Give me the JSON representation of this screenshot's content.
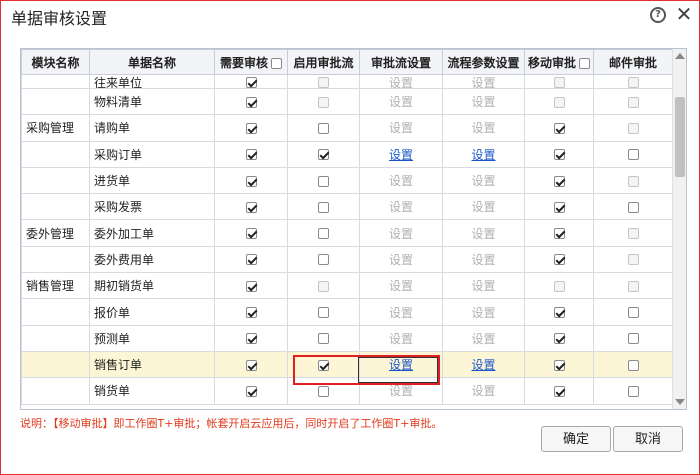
{
  "dialog": {
    "title": "单据审核设置"
  },
  "icons": {
    "help": "help-icon",
    "close": "close-icon"
  },
  "headers": {
    "module": "模块名称",
    "doc": "单据名称",
    "need_audit": "需要审核",
    "enable_flow": "启用审批流",
    "flow_setting": "审批流设置",
    "flow_param": "流程参数设置",
    "mobile": "移动审批",
    "mail": "邮件审批"
  },
  "rows": [
    {
      "module": "",
      "doc": "往来单位",
      "need": true,
      "flow": false,
      "flow_dis": true,
      "set": "设置",
      "set_active": false,
      "param": "设置",
      "param_active": false,
      "mobile": false,
      "mobile_dis": true,
      "mail": false,
      "mail_dis": true
    },
    {
      "module": "",
      "doc": "物料清单",
      "need": true,
      "flow": false,
      "flow_dis": true,
      "set": "设置",
      "set_active": false,
      "param": "设置",
      "param_active": false,
      "mobile": false,
      "mobile_dis": true,
      "mail": false,
      "mail_dis": true
    },
    {
      "module": "采购管理",
      "doc": "请购单",
      "need": true,
      "flow": false,
      "flow_dis": false,
      "set": "设置",
      "set_active": false,
      "param": "设置",
      "param_active": false,
      "mobile": true,
      "mobile_dis": false,
      "mail": false,
      "mail_dis": true
    },
    {
      "module": "",
      "doc": "采购订单",
      "need": true,
      "flow": true,
      "flow_dis": false,
      "set": "设置",
      "set_active": true,
      "param": "设置",
      "param_active": true,
      "mobile": true,
      "mobile_dis": false,
      "mail": false,
      "mail_dis": false
    },
    {
      "module": "",
      "doc": "进货单",
      "need": true,
      "flow": false,
      "flow_dis": false,
      "set": "设置",
      "set_active": false,
      "param": "设置",
      "param_active": false,
      "mobile": true,
      "mobile_dis": false,
      "mail": false,
      "mail_dis": true
    },
    {
      "module": "",
      "doc": "采购发票",
      "need": true,
      "flow": false,
      "flow_dis": false,
      "set": "设置",
      "set_active": false,
      "param": "设置",
      "param_active": false,
      "mobile": true,
      "mobile_dis": false,
      "mail": false,
      "mail_dis": false
    },
    {
      "module": "委外管理",
      "doc": "委外加工单",
      "need": true,
      "flow": false,
      "flow_dis": false,
      "set": "设置",
      "set_active": false,
      "param": "设置",
      "param_active": false,
      "mobile": true,
      "mobile_dis": false,
      "mail": false,
      "mail_dis": true
    },
    {
      "module": "",
      "doc": "委外费用单",
      "need": true,
      "flow": false,
      "flow_dis": false,
      "set": "设置",
      "set_active": false,
      "param": "设置",
      "param_active": false,
      "mobile": true,
      "mobile_dis": false,
      "mail": false,
      "mail_dis": true
    },
    {
      "module": "销售管理",
      "doc": "期初销货单",
      "need": true,
      "flow": false,
      "flow_dis": true,
      "set": "设置",
      "set_active": false,
      "param": "设置",
      "param_active": false,
      "mobile": false,
      "mobile_dis": true,
      "mail": false,
      "mail_dis": true
    },
    {
      "module": "",
      "doc": "报价单",
      "need": true,
      "flow": false,
      "flow_dis": false,
      "set": "设置",
      "set_active": false,
      "param": "设置",
      "param_active": false,
      "mobile": true,
      "mobile_dis": false,
      "mail": false,
      "mail_dis": false
    },
    {
      "module": "",
      "doc": "预测单",
      "need": true,
      "flow": false,
      "flow_dis": false,
      "set": "设置",
      "set_active": false,
      "param": "设置",
      "param_active": false,
      "mobile": true,
      "mobile_dis": false,
      "mail": false,
      "mail_dis": false
    },
    {
      "module": "",
      "doc": "销售订单",
      "need": true,
      "flow": true,
      "flow_dis": false,
      "set": "设置",
      "set_active": true,
      "param": "设置",
      "param_active": true,
      "mobile": true,
      "mobile_dis": false,
      "mail": false,
      "mail_dis": false,
      "selected": true
    },
    {
      "module": "",
      "doc": "销货单",
      "need": true,
      "flow": false,
      "flow_dis": false,
      "set": "设置",
      "set_active": false,
      "param": "设置",
      "param_active": false,
      "mobile": true,
      "mobile_dis": false,
      "mail": false,
      "mail_dis": false
    }
  ],
  "note": "说明：【移动审批】即工作圈T+审批；帐套开启云应用后，同时开启了工作圈T+审批。",
  "buttons": {
    "ok": "确定",
    "cancel": "取消"
  },
  "colors": {
    "accent_red": "#e03030",
    "link_blue": "#1a56c8",
    "note_red": "#e03a1e",
    "selected_row": "#fdf6d6"
  }
}
